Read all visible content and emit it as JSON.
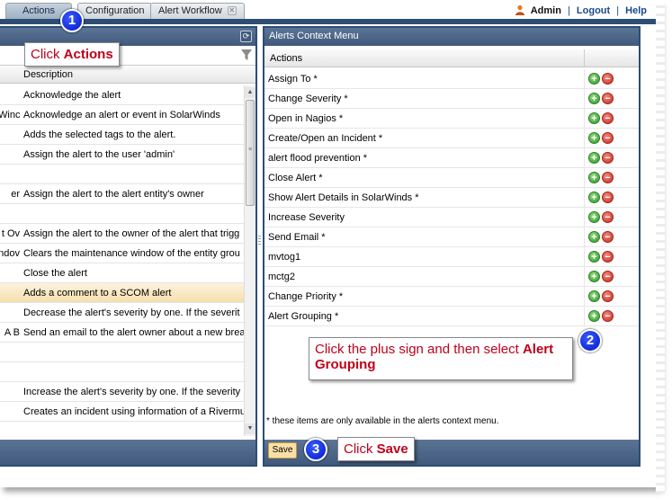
{
  "tabs": [
    {
      "label": "Actions"
    },
    {
      "label": "Configuration"
    },
    {
      "label": "Alert Workflow"
    }
  ],
  "top_links": {
    "user": "Admin",
    "logout": "Logout",
    "help": "Help"
  },
  "left_panel": {
    "column_header": "Description",
    "rows": [
      {
        "name": "",
        "description": "Acknowledge the alert"
      },
      {
        "name": "Winc",
        "description": "Acknowledge an alert or event in SolarWinds"
      },
      {
        "name": "",
        "description": "Adds the selected tags to the alert."
      },
      {
        "name": "",
        "description": "Assign the alert to the user 'admin'"
      },
      {
        "name": "",
        "description": ""
      },
      {
        "name": "er",
        "description": "Assign the alert to the alert entity's owner"
      },
      {
        "name": "",
        "description": ""
      },
      {
        "name": "t Ov",
        "description": "Assign the alert to the owner of the alert that trigg"
      },
      {
        "name": "ndov",
        "description": "Clears the maintenance window of the entity grou"
      },
      {
        "name": "",
        "description": "Close the alert"
      },
      {
        "name": "",
        "description": "Adds a comment to a SCOM alert"
      },
      {
        "name": "",
        "description": "Decrease the alert's severity by one. If the severit"
      },
      {
        "name": "A B",
        "description": "Send an email to the alert owner about a new brea"
      },
      {
        "name": "",
        "description": ""
      },
      {
        "name": "",
        "description": ""
      },
      {
        "name": "",
        "description": "Increase the alert's severity by one. If the severity"
      },
      {
        "name": "",
        "description": "Creates an incident using information of a Rivermu"
      }
    ],
    "highlighted_row": 10
  },
  "right_panel": {
    "title": "Alerts Context Menu",
    "column_header": "Actions",
    "rows": [
      "Assign To *",
      "Change Severity *",
      "Open in Nagios *",
      "Create/Open an Incident *",
      "alert flood prevention *",
      "Close Alert *",
      "Show Alert Details in SolarWinds *",
      "Increase Severity",
      "Send Email *",
      "mvtog1",
      "mctg2",
      "Change Priority *",
      "Alert Grouping *"
    ],
    "footnote": "* these items are only available in the alerts context menu.",
    "save_label": "Save"
  },
  "callouts": {
    "c1_prefix": "Click ",
    "c1_bold": "Actions",
    "c2_prefix": "Click the plus sign and then select ",
    "c2_bold": "Alert Grouping",
    "c3_prefix": "Click ",
    "c3_bold": "Save",
    "n1": "1",
    "n2": "2",
    "n3": "3"
  },
  "colors": {
    "accent": "#2e4d73",
    "callout_text": "#c0001a",
    "step_badge": "#0016c8"
  }
}
